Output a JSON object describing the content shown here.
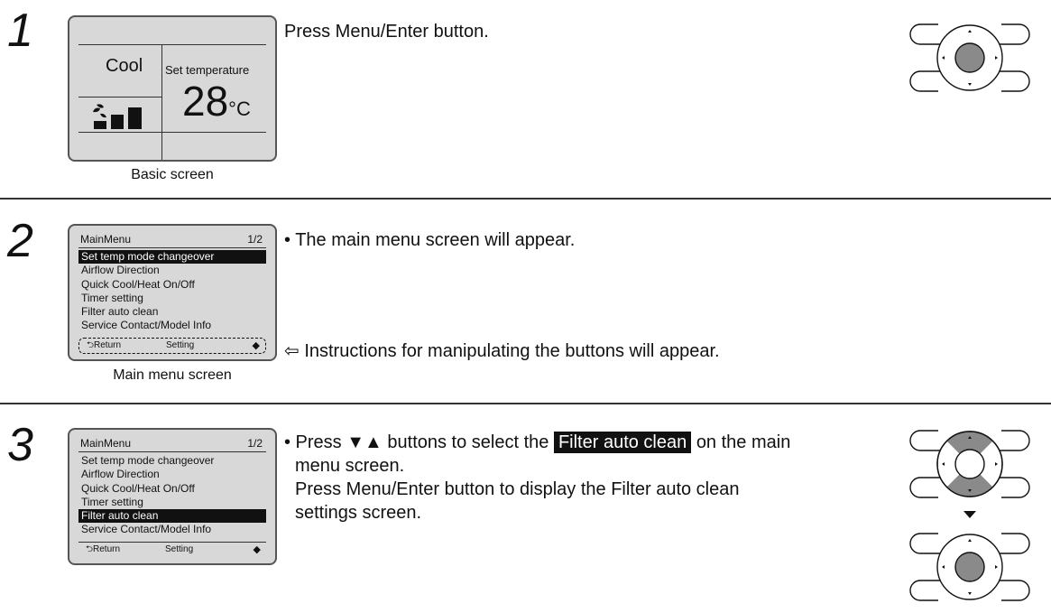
{
  "steps": [
    {
      "number": "1",
      "instruction": "Press Menu/Enter button.",
      "caption": "Basic screen",
      "basic_screen": {
        "mode": "Cool",
        "set_label": "Set temperature",
        "temperature": "28",
        "unit": "°C"
      }
    },
    {
      "number": "2",
      "bullet": "• The main menu screen will appear.",
      "note": "⇦ Instructions for manipulating the buttons will appear.",
      "caption": "Main menu screen",
      "menu": {
        "title": "MainMenu",
        "page": "1/2",
        "items": [
          "Set temp mode changeover",
          "Airflow Direction",
          "Quick Cool/Heat On/Off",
          "Timer setting",
          "Filter auto clean",
          "Service Contact/Model Info"
        ],
        "selected_index": 0,
        "footer_return": "Return",
        "footer_setting": "Setting"
      }
    },
    {
      "number": "3",
      "line1_pre": "• Press ▼▲ buttons to select the",
      "line1_highlight": "Filter auto clean",
      "line1_post": "on the main",
      "line2": "menu screen.",
      "line3": "Press Menu/Enter button to display the Filter auto clean",
      "line4": "settings screen.",
      "menu": {
        "title": "MainMenu",
        "page": "1/2",
        "items": [
          "Set temp mode changeover",
          "Airflow Direction",
          "Quick Cool/Heat On/Off",
          "Timer setting",
          "Filter auto clean",
          "Service Contact/Model Info"
        ],
        "selected_index": 4,
        "footer_return": "Return",
        "footer_setting": "Setting"
      }
    }
  ],
  "icons": {
    "remote_pad": "remote-pad-icon",
    "fan": "fan-icon",
    "arrow_down": "arrow-down-icon"
  }
}
